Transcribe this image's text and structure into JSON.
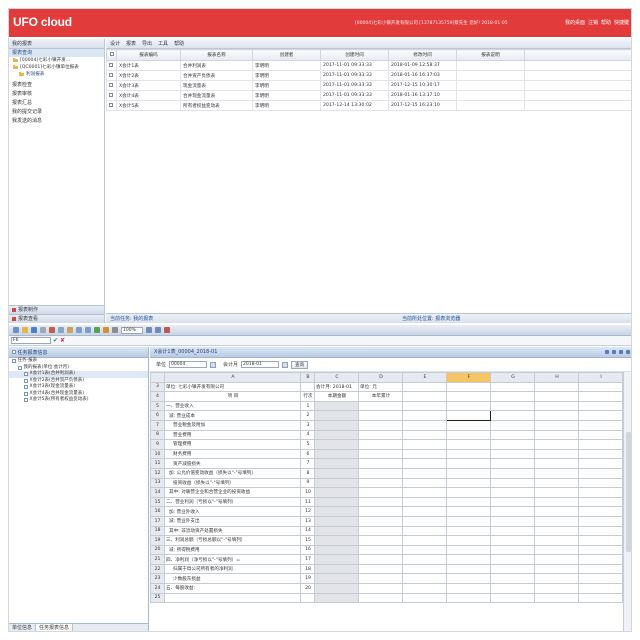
{
  "top": {
    "brand": "UFO cloud",
    "userinfo": "[00004]七彩小镇开发有限公司 [13787135759]蔡先生 您好! 2018-01-05",
    "links": [
      "我的桌面",
      "注销",
      "帮助",
      "快捷键"
    ],
    "left_header": "我的报表",
    "tree_caption": "报表查询",
    "tree": [
      {
        "label": "[00004]七彩小镇开发...",
        "indent": false
      },
      {
        "label": "[QC0001]七彩小镇单位报表",
        "indent": false
      },
      {
        "label": "利润报表",
        "indent": true
      }
    ],
    "left_items": [
      "报表检查",
      "报表审核",
      "报表汇总",
      "我的提交记录",
      "我发送的消息"
    ],
    "left_bottom": [
      "报表制作",
      "报表查看"
    ],
    "menu": [
      "设计",
      "报表",
      "导出",
      "工具",
      "帮助"
    ],
    "columns": [
      "报表编码",
      "报表名称",
      "创建者",
      "创建时间",
      "修改时间",
      "报表说明"
    ],
    "rows": [
      [
        "X会计1表",
        "合并利润表",
        "李明明",
        "2017-11-01 09:33:33",
        "2018-01-09 12:58:37",
        ""
      ],
      [
        "X会计2表",
        "合并资产负债表",
        "李明明",
        "2017-11-01 09:33:33",
        "2018-01-16 16:37:03",
        ""
      ],
      [
        "X会计3表",
        "现金流量表",
        "李明明",
        "2017-11-01 09:33:33",
        "2017-12-15 10:30:17",
        ""
      ],
      [
        "X会计4表",
        "合并现金流量表",
        "李明明",
        "2017-11-01 09:33:33",
        "2018-01-16 13:37:10",
        ""
      ],
      [
        "X会计5表",
        "所有者权益变动表",
        "李明明",
        "2017-12-14 13:30:02",
        "2017-12-15 16:23:10",
        ""
      ]
    ],
    "status_left": "当前任务: 我的报表",
    "status_right": "当前所处位置: 报表浏览器"
  },
  "bottom": {
    "zoom": "100%",
    "namebox": "F6",
    "left_header": "任务报表信息",
    "tree": [
      {
        "label": "任务-报表",
        "indent": 0
      },
      {
        "label": "我的报表(单位:会计月)",
        "indent": 1
      },
      {
        "label": "X会计1表(合并利润表)",
        "indent": 2
      },
      {
        "label": "X会计2表(合并资产负债表)",
        "indent": 2
      },
      {
        "label": "X会计3表(现金流量表)",
        "indent": 2
      },
      {
        "label": "X会计4表(合并现金流量表)",
        "indent": 2
      },
      {
        "label": "X会计5表(所有者权益变动表)",
        "indent": 2
      }
    ],
    "tabs": [
      "单位信息",
      "任务报表信息"
    ],
    "doc_tab": "X会计1表_00004_2018-01",
    "param_unit_label": "单位",
    "param_unit_value": "00004",
    "param_period_label": "会计月",
    "param_period_value": "2018-01",
    "query_button": "查询",
    "col_letters": [
      "",
      "A",
      "B",
      "C",
      "D",
      "E",
      "F",
      "G",
      "H",
      "I"
    ],
    "sheet_rows": [
      {
        "n": "3",
        "a": "单位: 七彩小镇开发有限公司",
        "b": "",
        "c": "会计月: 2018-01",
        "d": "单位: 元"
      },
      {
        "n": "4",
        "a": "项     目",
        "b": "行次",
        "c": "本期金额",
        "d": "本年累计"
      },
      {
        "n": "5",
        "a": "一、营业收入",
        "b": "1",
        "c": "",
        "d": ""
      },
      {
        "n": "6",
        "a": "减: 营业成本",
        "b": "2",
        "c": "",
        "d": ""
      },
      {
        "n": "7",
        "a": "营业税金及附加",
        "b": "3",
        "c": "",
        "d": ""
      },
      {
        "n": "8",
        "a": "营业费用",
        "b": "4",
        "c": "",
        "d": ""
      },
      {
        "n": "9",
        "a": "管理费用",
        "b": "5",
        "c": "",
        "d": ""
      },
      {
        "n": "10",
        "a": "财务费用",
        "b": "6",
        "c": "",
        "d": ""
      },
      {
        "n": "11",
        "a": "资产减值损失",
        "b": "7",
        "c": "",
        "d": ""
      },
      {
        "n": "12",
        "a": "加: 公允价值变动收益（损失以\"-\"号填列）",
        "b": "8",
        "c": "",
        "d": ""
      },
      {
        "n": "13",
        "a": "投资收益（损失以\"-\"号填列）",
        "b": "9",
        "c": "",
        "d": ""
      },
      {
        "n": "14",
        "a": "其中: 对联营企业和合营企业的投资收益",
        "b": "10",
        "c": "",
        "d": ""
      },
      {
        "n": "15",
        "a": "二、营业利润（亏损以\"-\"号填列）",
        "b": "11",
        "c": "",
        "d": ""
      },
      {
        "n": "16",
        "a": "加: 营业外收入",
        "b": "12",
        "c": "",
        "d": ""
      },
      {
        "n": "17",
        "a": "减: 营业外支出",
        "b": "13",
        "c": "",
        "d": ""
      },
      {
        "n": "18",
        "a": "其中: 非流动资产处置损失",
        "b": "14",
        "c": "",
        "d": ""
      },
      {
        "n": "19",
        "a": "三、利润总额（亏损总额以\"-\"号填列）",
        "b": "15",
        "c": "",
        "d": ""
      },
      {
        "n": "20",
        "a": "减: 所得税费用",
        "b": "16",
        "c": "",
        "d": ""
      },
      {
        "n": "21",
        "a": "四、净利润（净亏损以\"-\"号填列）=",
        "b": "17",
        "c": "",
        "d": ""
      },
      {
        "n": "22",
        "a": "归属于母公司所有者的净利润",
        "b": "18",
        "c": "",
        "d": ""
      },
      {
        "n": "23",
        "a": "少数股东损益",
        "b": "19",
        "c": "",
        "d": ""
      },
      {
        "n": "24",
        "a": "五、每股收益:",
        "b": "20",
        "c": "",
        "d": ""
      },
      {
        "n": "25",
        "a": "",
        "b": "",
        "c": "",
        "d": ""
      }
    ]
  }
}
